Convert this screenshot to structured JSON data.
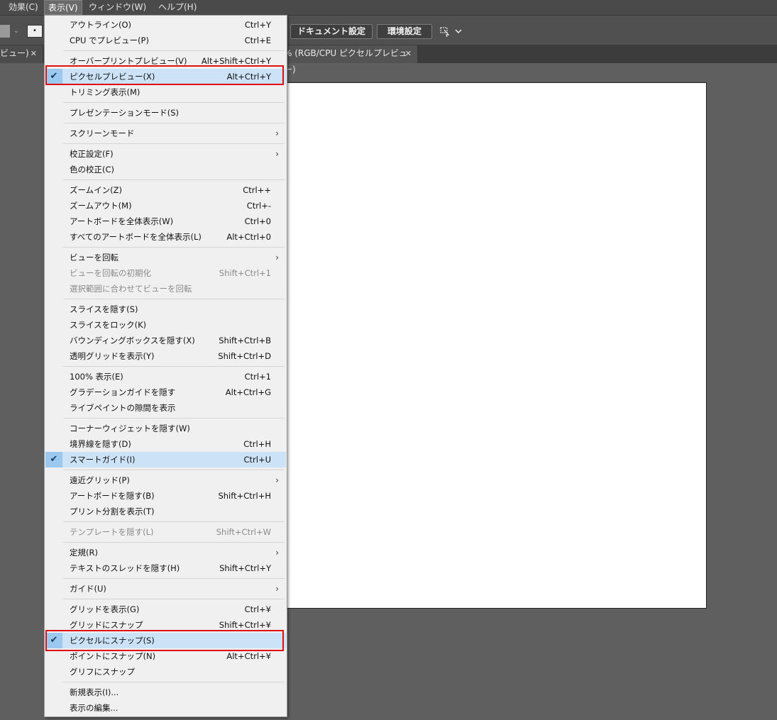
{
  "menubar": {
    "items": [
      {
        "label": "効果(C)"
      },
      {
        "label": "表示(V)"
      },
      {
        "label": "ウィンドウ(W)"
      },
      {
        "label": "ヘルプ(H)"
      }
    ]
  },
  "controlbar": {
    "document_settings": "ドキュメント設定",
    "preferences": "環境設定"
  },
  "tabs": {
    "left_label": "ビュー)",
    "main_label": "% (RGB/CPU ピクセルプレビュー)"
  },
  "menu": {
    "items": [
      {
        "label": "アウトライン(O)",
        "shortcut": "Ctrl+Y"
      },
      {
        "label": "CPU でプレビュー(P)",
        "shortcut": "Ctrl+E"
      },
      {
        "label": "オーバープリントプレビュー(V)",
        "shortcut": "Alt+Shift+Ctrl+Y"
      },
      {
        "label": "ピクセルプレビュー(X)",
        "shortcut": "Alt+Ctrl+Y",
        "checked": true
      },
      {
        "label": "トリミング表示(M)",
        "shortcut": ""
      },
      {
        "label": "プレゼンテーションモード(S)",
        "shortcut": ""
      },
      {
        "label": "スクリーンモード",
        "shortcut": "",
        "submenu": true
      },
      {
        "label": "校正設定(F)",
        "shortcut": "",
        "submenu": true
      },
      {
        "label": "色の校正(C)",
        "shortcut": ""
      },
      {
        "label": "ズームイン(Z)",
        "shortcut": "Ctrl++"
      },
      {
        "label": "ズームアウト(M)",
        "shortcut": "Ctrl+-"
      },
      {
        "label": "アートボードを全体表示(W)",
        "shortcut": "Ctrl+0"
      },
      {
        "label": "すべてのアートボードを全体表示(L)",
        "shortcut": "Alt+Ctrl+0"
      },
      {
        "label": "ビューを回転",
        "shortcut": "",
        "submenu": true
      },
      {
        "label": "ビューを回転の初期化",
        "shortcut": "Shift+Ctrl+1",
        "disabled": true
      },
      {
        "label": "選択範囲に合わせてビューを回転",
        "shortcut": "",
        "disabled": true
      },
      {
        "label": "スライスを隠す(S)",
        "shortcut": ""
      },
      {
        "label": "スライスをロック(K)",
        "shortcut": ""
      },
      {
        "label": "バウンディングボックスを隠す(X)",
        "shortcut": "Shift+Ctrl+B"
      },
      {
        "label": "透明グリッドを表示(Y)",
        "shortcut": "Shift+Ctrl+D"
      },
      {
        "label": "100% 表示(E)",
        "shortcut": "Ctrl+1"
      },
      {
        "label": "グラデーションガイドを隠す",
        "shortcut": "Alt+Ctrl+G"
      },
      {
        "label": "ライブペイントの隙間を表示",
        "shortcut": ""
      },
      {
        "label": "コーナーウィジェットを隠す(W)",
        "shortcut": ""
      },
      {
        "label": "境界線を隠す(D)",
        "shortcut": "Ctrl+H"
      },
      {
        "label": "スマートガイド(I)",
        "shortcut": "Ctrl+U",
        "checked": true
      },
      {
        "label": "遠近グリッド(P)",
        "shortcut": "",
        "submenu": true
      },
      {
        "label": "アートボードを隠す(B)",
        "shortcut": "Shift+Ctrl+H"
      },
      {
        "label": "プリント分割を表示(T)",
        "shortcut": ""
      },
      {
        "label": "テンプレートを隠す(L)",
        "shortcut": "Shift+Ctrl+W",
        "disabled": true
      },
      {
        "label": "定規(R)",
        "shortcut": "",
        "submenu": true
      },
      {
        "label": "テキストのスレッドを隠す(H)",
        "shortcut": "Shift+Ctrl+Y"
      },
      {
        "label": "ガイド(U)",
        "shortcut": "",
        "submenu": true
      },
      {
        "label": "グリッドを表示(G)",
        "shortcut": "Ctrl+¥"
      },
      {
        "label": "グリッドにスナップ",
        "shortcut": "Shift+Ctrl+¥"
      },
      {
        "label": "ピクセルにスナップ(S)",
        "shortcut": "",
        "checked": true
      },
      {
        "label": "ポイントにスナップ(N)",
        "shortcut": "Alt+Ctrl+¥"
      },
      {
        "label": "グリフにスナップ",
        "shortcut": ""
      },
      {
        "label": "新規表示(I)...",
        "shortcut": ""
      },
      {
        "label": "表示の編集...",
        "shortcut": ""
      }
    ]
  }
}
